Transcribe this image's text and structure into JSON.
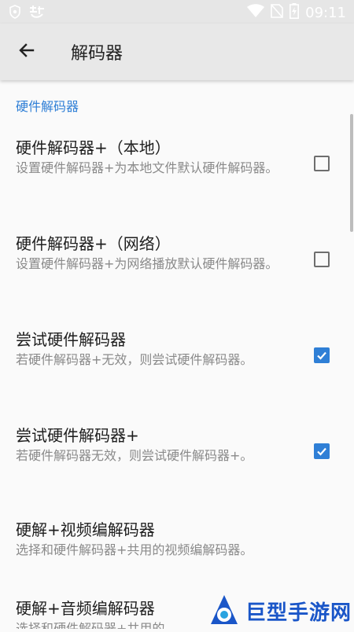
{
  "status_bar": {
    "time": "09:11"
  },
  "toolbar": {
    "title": "解码器"
  },
  "section": {
    "header": "硬件解码器"
  },
  "settings": [
    {
      "title": "硬件解码器+（本地）",
      "description": "设置硬件解码器+为本地文件默认硬件解码器。",
      "checked": false
    },
    {
      "title": "硬件解码器+（网络）",
      "description": "设置硬件解码器+为网络播放默认硬件解码器。",
      "checked": false
    },
    {
      "title": "尝试硬件解码器",
      "description": "若硬件解码器+无效，则尝试硬件解码器。",
      "checked": true
    },
    {
      "title": "尝试硬件解码器+",
      "description": "若硬件解码器无效，则尝试硬件解码器+。",
      "checked": true
    },
    {
      "title": "硬解+视频编解码器",
      "description": "选择和硬件解码器+共用的视频编解码器。"
    },
    {
      "title": "硬解+音频编解码器",
      "description": "选择和硬件解码器+共用的"
    }
  ],
  "watermark": {
    "text": "巨型手游网"
  },
  "colors": {
    "accent": "#2f7fd6",
    "toolbar": "#e8e8e8"
  }
}
